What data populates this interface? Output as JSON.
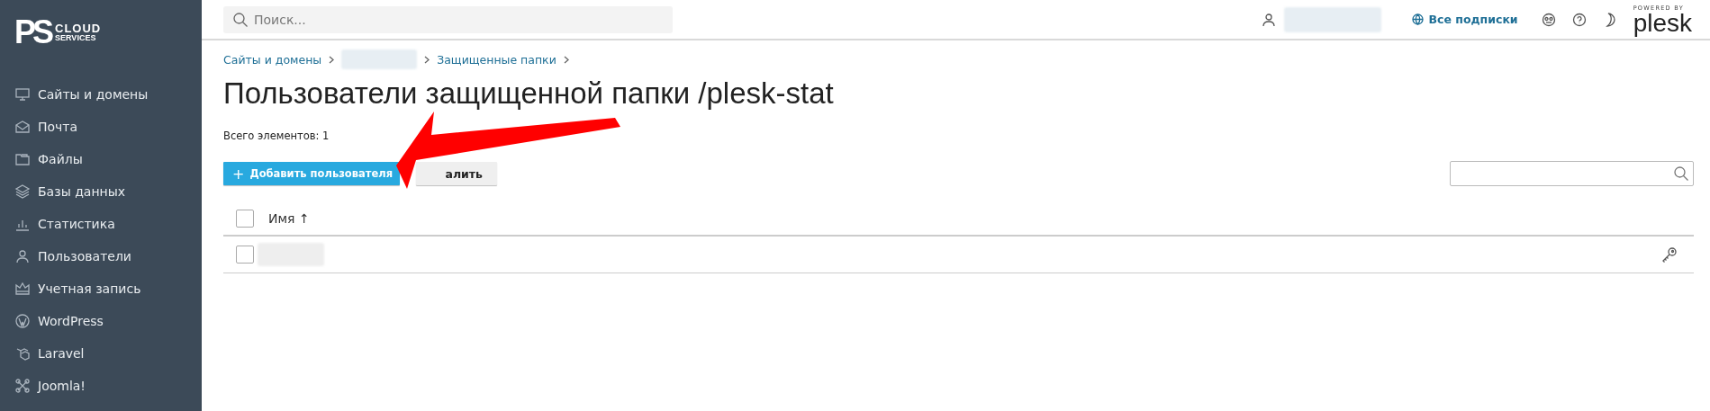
{
  "logo": {
    "mark": "PS",
    "line_1": "CLOUD",
    "line_2": "SERVICES"
  },
  "sidebar": {
    "items": [
      {
        "label": "Сайты и домены",
        "selected": false
      },
      {
        "label": "Почта",
        "selected": false
      },
      {
        "label": "Файлы",
        "selected": false
      },
      {
        "label": "Базы данных",
        "selected": false
      },
      {
        "label": "Статистика",
        "selected": false
      },
      {
        "label": "Пользователи",
        "selected": false
      },
      {
        "label": "Учетная запись",
        "selected": false
      },
      {
        "label": "WordPress",
        "selected": false
      },
      {
        "label": "Laravel",
        "selected": false
      },
      {
        "label": "Joomla!",
        "selected": false
      }
    ]
  },
  "topbar": {
    "search": {
      "placeholder": "Поиск..."
    },
    "subscriptions": "Все подписки",
    "powered_by": "POWERED BY",
    "brand": "plesk"
  },
  "breadcrumbs": [
    "Сайты и домены",
    "Защищенные папки"
  ],
  "title": "Пользователи защищенной папки /plesk-stat",
  "total": "Всего элементов: 1",
  "buttons": [
    {
      "kind": "primary",
      "icon": "+",
      "label": "Добавить пользователя"
    },
    {
      "kind": "secondary",
      "label": "алить"
    }
  ],
  "table": {
    "columns": [
      {
        "label": "Имя",
        "sort": "↑"
      }
    ],
    "rows": [
      {
        "checked": false
      }
    ]
  },
  "header_checkbox": {
    "checked": false
  }
}
